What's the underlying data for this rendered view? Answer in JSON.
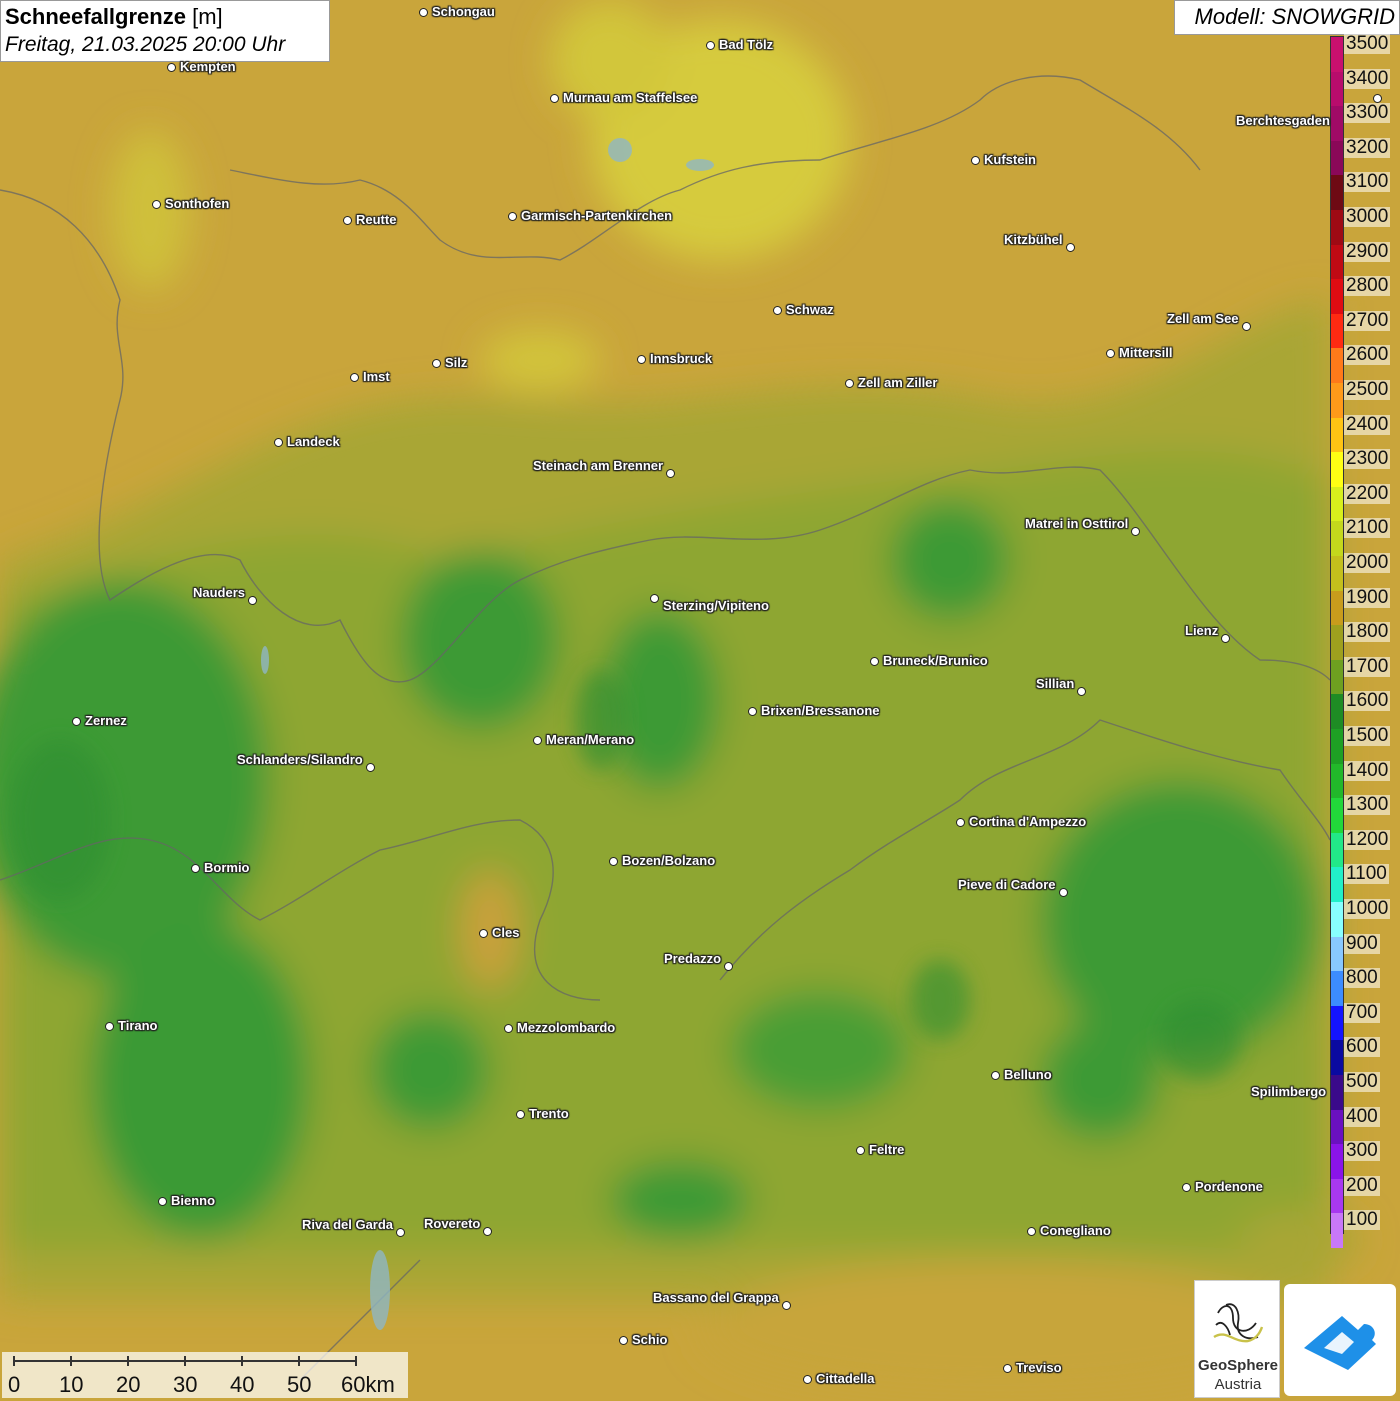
{
  "title": {
    "main": "Schneefallgrenze",
    "unit": "[m]",
    "datetime": "Freitag, 21.03.2025 20:00 Uhr"
  },
  "model": "Modell: SNOWGRID",
  "legend": [
    {
      "value": "3500",
      "color": "#c8106e"
    },
    {
      "value": "3400",
      "color": "#b80c6c"
    },
    {
      "value": "3300",
      "color": "#a00a66"
    },
    {
      "value": "3200",
      "color": "#8a0858"
    },
    {
      "value": "3100",
      "color": "#6e0a14"
    },
    {
      "value": "3000",
      "color": "#9e0a14"
    },
    {
      "value": "2900",
      "color": "#c00a14"
    },
    {
      "value": "2800",
      "color": "#e00c12"
    },
    {
      "value": "2700",
      "color": "#ff2a12"
    },
    {
      "value": "2600",
      "color": "#ff7a1a"
    },
    {
      "value": "2500",
      "color": "#ff9a1a"
    },
    {
      "value": "2400",
      "color": "#ffc414"
    },
    {
      "value": "2300",
      "color": "#ffff14"
    },
    {
      "value": "2200",
      "color": "#d8f01c"
    },
    {
      "value": "2100",
      "color": "#c4d81c"
    },
    {
      "value": "2000",
      "color": "#c4c01c"
    },
    {
      "value": "1900",
      "color": "#c89c1c"
    },
    {
      "value": "1800",
      "color": "#9ea01e"
    },
    {
      "value": "1700",
      "color": "#6ea020"
    },
    {
      "value": "1600",
      "color": "#1e8c24"
    },
    {
      "value": "1500",
      "color": "#1ea024"
    },
    {
      "value": "1400",
      "color": "#22b82a"
    },
    {
      "value": "1300",
      "color": "#22d83a"
    },
    {
      "value": "1200",
      "color": "#22e888"
    },
    {
      "value": "1100",
      "color": "#22f0c8"
    },
    {
      "value": "1000",
      "color": "#88ffff"
    },
    {
      "value": "900",
      "color": "#88c8ff"
    },
    {
      "value": "800",
      "color": "#3c8cff"
    },
    {
      "value": "700",
      "color": "#1414ff"
    },
    {
      "value": "600",
      "color": "#0a0aa0"
    },
    {
      "value": "500",
      "color": "#3a0a8a"
    },
    {
      "value": "400",
      "color": "#6a10c0"
    },
    {
      "value": "300",
      "color": "#8a14e8"
    },
    {
      "value": "200",
      "color": "#a838f0"
    },
    {
      "value": "100",
      "color": "#c878f8"
    }
  ],
  "cities": [
    {
      "name": "Schongau"
    },
    {
      "name": "Bad Tölz"
    },
    {
      "name": "Kempten"
    },
    {
      "name": "Murnau am Staffelsee"
    },
    {
      "name": "Berchtesgaden"
    },
    {
      "name": "Kufstein"
    },
    {
      "name": "Sonthofen"
    },
    {
      "name": "Reutte"
    },
    {
      "name": "Garmisch-Partenkirchen"
    },
    {
      "name": "Kitzbühel"
    },
    {
      "name": "Schwaz"
    },
    {
      "name": "Zell am See"
    },
    {
      "name": "Innsbruck"
    },
    {
      "name": "Mittersill"
    },
    {
      "name": "Silz"
    },
    {
      "name": "Imst"
    },
    {
      "name": "Zell am Ziller"
    },
    {
      "name": "Landeck"
    },
    {
      "name": "Steinach am Brenner"
    },
    {
      "name": "Matrei in Osttirol"
    },
    {
      "name": "Nauders"
    },
    {
      "name": "Sterzing/Vipiteno"
    },
    {
      "name": "Lienz"
    },
    {
      "name": "Bruneck/Brunico"
    },
    {
      "name": "Sillian"
    },
    {
      "name": "Zernez"
    },
    {
      "name": "Brixen/Bressanone"
    },
    {
      "name": "Meran/Merano"
    },
    {
      "name": "Schlanders/Silandro"
    },
    {
      "name": "Cortina d'Ampezzo"
    },
    {
      "name": "Bozen/Bolzano"
    },
    {
      "name": "Bormio"
    },
    {
      "name": "Pieve di Cadore"
    },
    {
      "name": "Cles"
    },
    {
      "name": "Predazzo"
    },
    {
      "name": "Tirano"
    },
    {
      "name": "Mezzolombardo"
    },
    {
      "name": "Belluno"
    },
    {
      "name": "Spilimbergo"
    },
    {
      "name": "Trento"
    },
    {
      "name": "Feltre"
    },
    {
      "name": "Pordenone"
    },
    {
      "name": "Bienno"
    },
    {
      "name": "Riva del Garda"
    },
    {
      "name": "Rovereto"
    },
    {
      "name": "Conegliano"
    },
    {
      "name": "Bassano del Grappa"
    },
    {
      "name": "Schio"
    },
    {
      "name": "Treviso"
    },
    {
      "name": "Cittadella"
    }
  ],
  "scalebar": {
    "labels": [
      "0",
      "10",
      "20",
      "30",
      "40",
      "50",
      "60km"
    ]
  },
  "logos": {
    "geosphere_line1": "GeoSphere",
    "geosphere_line2": "Austria"
  }
}
